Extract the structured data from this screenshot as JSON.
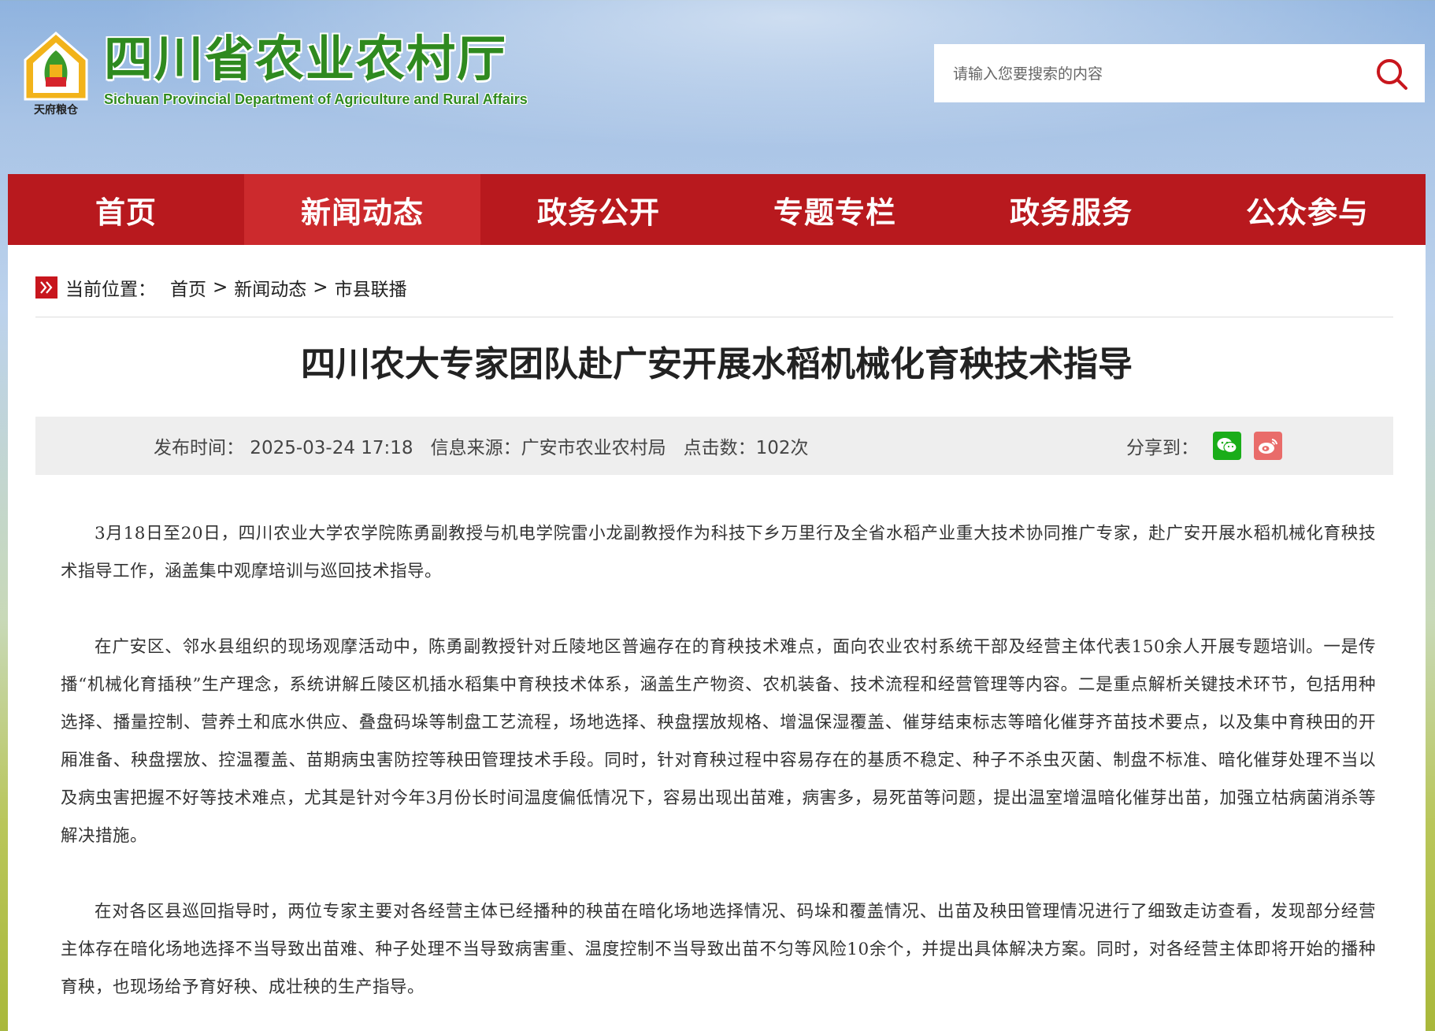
{
  "header": {
    "site_title": "四川省农业农村厅",
    "site_subtitle": "Sichuan Provincial Department of Agriculture and Rural Affairs",
    "logo_text": "天府粮仓",
    "search_placeholder": "请输入您要搜索的内容"
  },
  "nav": {
    "items": [
      {
        "label": "首页"
      },
      {
        "label": "新闻动态",
        "active": true
      },
      {
        "label": "政务公开"
      },
      {
        "label": "专题专栏"
      },
      {
        "label": "政务服务"
      },
      {
        "label": "公众参与"
      }
    ]
  },
  "breadcrumb": {
    "label": "当前位置：",
    "items": [
      "首页",
      "新闻动态",
      "市县联播"
    ],
    "separator": ">"
  },
  "article": {
    "title": "四川农大专家团队赴广安开展水稻机械化育秧技术指导",
    "meta": {
      "publish_time": "发布时间：  2025-03-24 17:18",
      "source": "信息来源：广安市农业农村局",
      "clicks": "点击数：102次",
      "share_label": "分享到："
    },
    "paragraphs": [
      "3月18日至20日，四川农业大学农学院陈勇副教授与机电学院雷小龙副教授作为科技下乡万里行及全省水稻产业重大技术协同推广专家，赴广安开展水稻机械化育秧技术指导工作，涵盖集中观摩培训与巡回技术指导。",
      "在广安区、邻水县组织的现场观摩活动中，陈勇副教授针对丘陵地区普遍存在的育秧技术难点，面向农业农村系统干部及经营主体代表150余人开展专题培训。一是传播“机械化育插秧”生产理念，系统讲解丘陵区机插水稻集中育秧技术体系，涵盖生产物资、农机装备、技术流程和经营管理等内容。二是重点解析关键技术环节，包括用种选择、播量控制、营养土和底水供应、叠盘码垛等制盘工艺流程，场地选择、秧盘摆放规格、增温保湿覆盖、催芽结束标志等暗化催芽齐苗技术要点，以及集中育秧田的开厢准备、秧盘摆放、控温覆盖、苗期病虫害防控等秧田管理技术手段。同时，针对育秧过程中容易存在的基质不稳定、种子不杀虫灭菌、制盘不标准、暗化催芽处理不当以及病虫害把握不好等技术难点，尤其是针对今年3月份长时间温度偏低情况下，容易出现出苗难，病害多，易死苗等问题，提出温室增温暗化催芽出苗，加强立枯病菌消杀等解决措施。",
      "在对各区县巡回指导时，两位专家主要对各经营主体已经播种的秧苗在暗化场地选择情况、码垛和覆盖情况、出苗及秧田管理情况进行了细致走访查看，发现部分经营主体存在暗化场地选择不当导致出苗难、种子处理不当导致病害重、温度控制不当导致出苗不匀等风险10余个，并提出具体解决方案。同时，对各经营主体即将开始的播种育秧，也现场给予育好秧、成壮秧的生产指导。"
    ]
  },
  "colors": {
    "nav_bg": "#b8191e",
    "nav_active": "#cc2a2d",
    "title_green": "#2f8a1f",
    "wechat": "#1aad19",
    "weibo": "#e96c6a"
  },
  "icons": {
    "search": "search-icon",
    "breadcrumb": "double-chevron-right-icon",
    "wechat": "wechat-icon",
    "weibo": "weibo-icon"
  }
}
